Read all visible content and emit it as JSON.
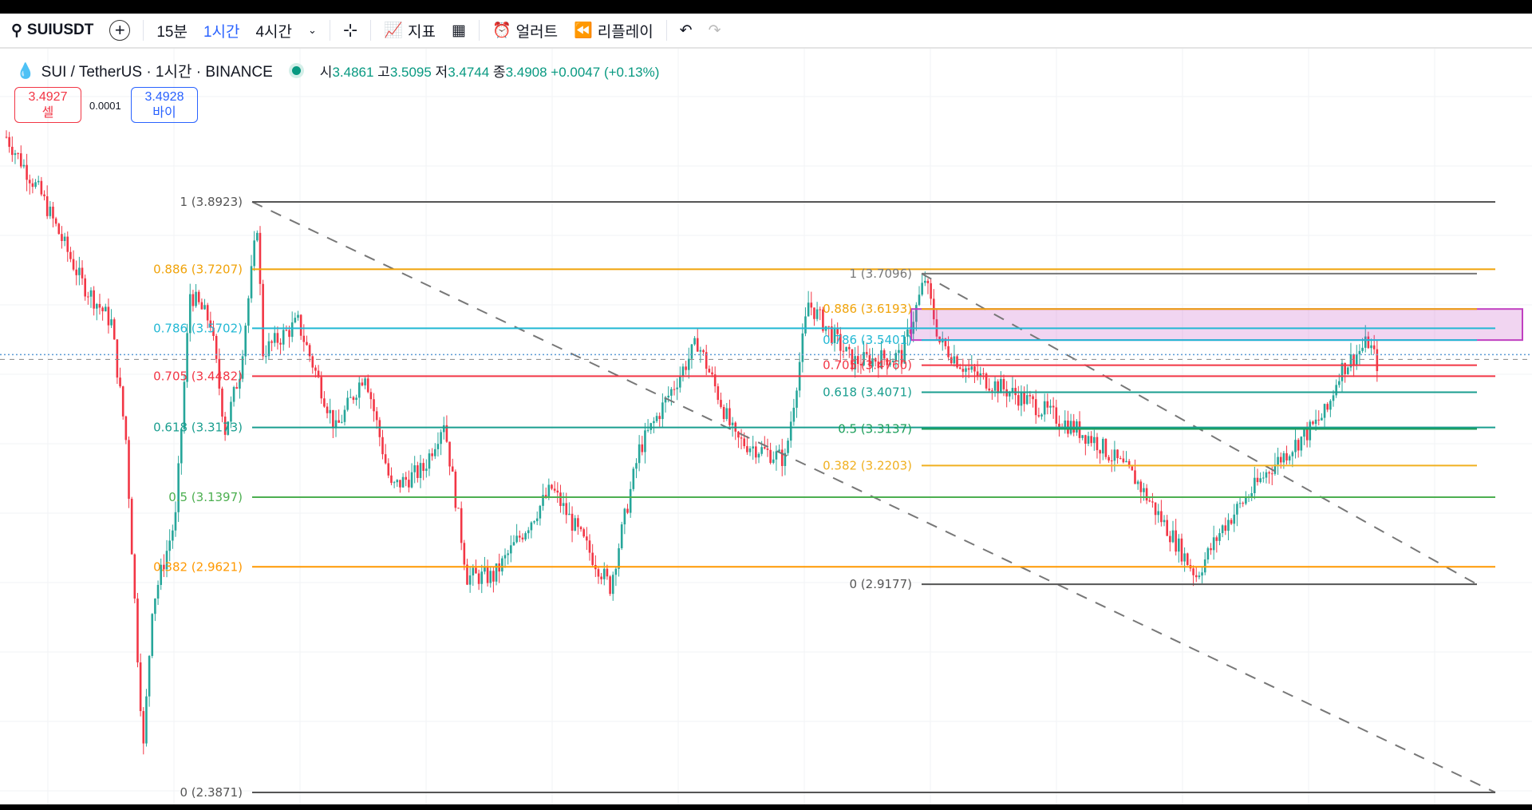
{
  "toolbar": {
    "symbol": "SUIUSDT",
    "intervals": [
      "15분",
      "1시간",
      "4시간"
    ],
    "active_interval": "1시간",
    "indicators": "지표",
    "alert": "얼러트",
    "replay": "리플레이"
  },
  "legend": {
    "title": "SUI / TetherUS · 1시간 · BINANCE",
    "o_label": "시",
    "o": "3.4861",
    "h_label": "고",
    "h": "3.5095",
    "l_label": "저",
    "l": "3.4744",
    "c_label": "종",
    "c": "3.4908",
    "change": "+0.0047 (+0.13%)"
  },
  "trade": {
    "sell_price": "3.4927",
    "sell_label": "셀",
    "spread": "0.0001",
    "buy_price": "3.4928",
    "buy_label": "바이"
  },
  "colors": {
    "up": "#26a69a",
    "down": "#f23645"
  },
  "fib1": {
    "levels": [
      {
        "label": "1 (3.8923)",
        "price": 3.8923,
        "color": "#555555"
      },
      {
        "label": "0.886 (3.7207)",
        "price": 3.7207,
        "color": "#f0a30a"
      },
      {
        "label": "0.786 (3.5702)",
        "price": 3.5702,
        "color": "#22b8d4"
      },
      {
        "label": "0.705 (3.4482)",
        "price": 3.4482,
        "color": "#f23645"
      },
      {
        "label": "0.618 (3.3173)",
        "price": 3.3173,
        "color": "#1a9e8f"
      },
      {
        "label": "0.5 (3.1397)",
        "price": 3.1397,
        "color": "#4caf50"
      },
      {
        "label": "0.382 (2.9621)",
        "price": 2.9621,
        "color": "#ff9800"
      },
      {
        "label": "0 (2.3871)",
        "price": 2.3871,
        "color": "#555555"
      }
    ]
  },
  "fib2": {
    "levels": [
      {
        "label": "1 (3.7096)",
        "price": 3.7096,
        "color": "#777777"
      },
      {
        "label": "0.886 (3.6193)",
        "price": 3.6193,
        "color": "#f0a30a"
      },
      {
        "label": "0.786 (3.5401)",
        "price": 3.5401,
        "color": "#22b8d4"
      },
      {
        "label": "0.705 (3.4760)",
        "price": 3.476,
        "color": "#f23645"
      },
      {
        "label": "0.618 (3.4071)",
        "price": 3.4071,
        "color": "#1a9e8f"
      },
      {
        "label": "0.5 (3.3137)",
        "price": 3.3137,
        "color": "#1a9e5a"
      },
      {
        "label": "0.382 (3.2203)",
        "price": 3.2203,
        "color": "#f0b020"
      },
      {
        "label": "0 (2.9177)",
        "price": 2.9177,
        "color": "#555555"
      }
    ]
  },
  "zone": {
    "top": 3.6193,
    "bottom": 3.5401,
    "color": "#c040c0"
  },
  "current_price": 3.4908,
  "price_path": [
    [
      0,
      4.058
    ],
    [
      12,
      3.909
    ],
    [
      26,
      3.685
    ],
    [
      36,
      3.585
    ],
    [
      41,
      3.286
    ],
    [
      45,
      2.738
    ],
    [
      47,
      2.5
    ],
    [
      50,
      2.863
    ],
    [
      58,
      3.087
    ],
    [
      63,
      3.66
    ],
    [
      70,
      3.585
    ],
    [
      75,
      3.311
    ],
    [
      80,
      3.46
    ],
    [
      86,
      3.834
    ],
    [
      88,
      3.51
    ],
    [
      100,
      3.585
    ],
    [
      113,
      3.311
    ],
    [
      123,
      3.46
    ],
    [
      132,
      3.162
    ],
    [
      143,
      3.211
    ],
    [
      150,
      3.336
    ],
    [
      158,
      2.937
    ],
    [
      167,
      2.937
    ],
    [
      187,
      3.162
    ],
    [
      207,
      2.912
    ],
    [
      217,
      3.261
    ],
    [
      237,
      3.535
    ],
    [
      250,
      3.286
    ],
    [
      267,
      3.236
    ],
    [
      275,
      3.635
    ],
    [
      290,
      3.485
    ],
    [
      307,
      3.5
    ],
    [
      315,
      3.697
    ],
    [
      320,
      3.535
    ],
    [
      330,
      3.46
    ],
    [
      350,
      3.386
    ],
    [
      373,
      3.286
    ],
    [
      387,
      3.187
    ],
    [
      400,
      3.037
    ],
    [
      408,
      2.94
    ],
    [
      417,
      3.062
    ],
    [
      433,
      3.211
    ],
    [
      447,
      3.311
    ],
    [
      453,
      3.361
    ],
    [
      457,
      3.46
    ],
    [
      467,
      3.535
    ],
    [
      470,
      3.48
    ]
  ]
}
